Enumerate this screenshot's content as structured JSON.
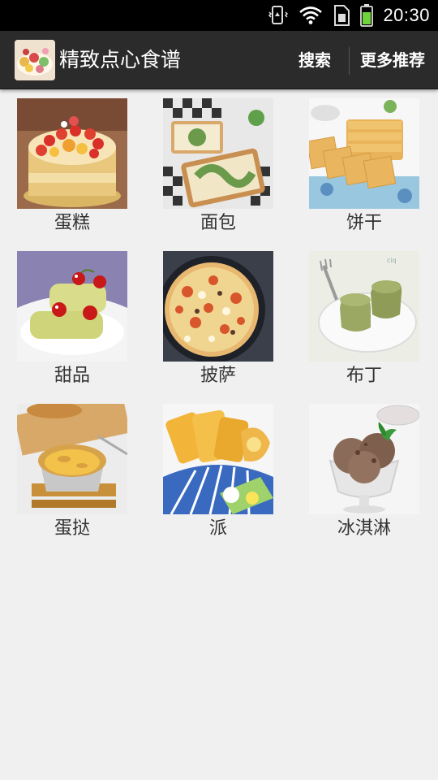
{
  "status_bar": {
    "time": "20:30",
    "icons": [
      "vibrate-icon",
      "wifi-icon",
      "sim-icon",
      "battery-icon"
    ]
  },
  "action_bar": {
    "title": "精致点心食谱",
    "search_label": "搜索",
    "more_label": "更多推荐"
  },
  "categories": [
    {
      "label": "蛋糕",
      "image": "cake-image"
    },
    {
      "label": "面包",
      "image": "bread-image"
    },
    {
      "label": "饼干",
      "image": "cookie-image"
    },
    {
      "label": "甜品",
      "image": "dessert-image"
    },
    {
      "label": "披萨",
      "image": "pizza-image"
    },
    {
      "label": "布丁",
      "image": "pudding-image"
    },
    {
      "label": "蛋挞",
      "image": "egg-tart-image"
    },
    {
      "label": "派",
      "image": "pie-image"
    },
    {
      "label": "冰淇淋",
      "image": "ice-cream-image"
    }
  ]
}
